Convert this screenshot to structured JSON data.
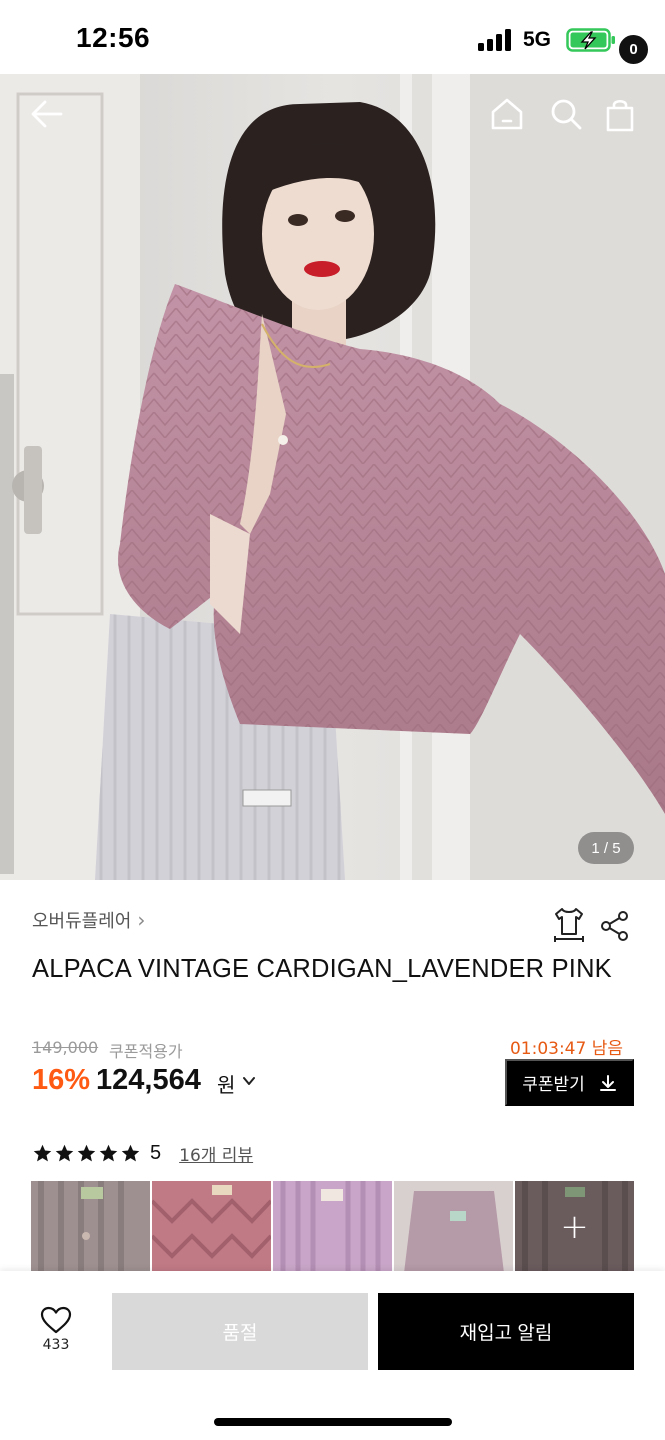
{
  "status_bar": {
    "time": "12:56",
    "network": "5G"
  },
  "header": {
    "cart_count": "0",
    "image_counter": "1 / 5"
  },
  "icons": {
    "back": "arrow-left-icon",
    "home": "home-icon",
    "search": "search-icon",
    "cart": "shopping-bag-icon",
    "fit": "size-fit-icon",
    "share": "share-icon",
    "chevron": "chevron-right-icon",
    "download": "download-icon",
    "wish": "heart-icon",
    "star": "star-icon"
  },
  "product": {
    "brand": "오버듀플레어",
    "brand_chevron": "›",
    "title": "ALPACA VINTAGE CARDIGAN_LAVENDER PINK",
    "original_price": "149,000",
    "coupon_label": "쿠폰적용가",
    "timer": "01:03:47 남음",
    "discount": "16%",
    "sale_price": "124,564",
    "currency": "원",
    "coupon_button": "쿠폰받기"
  },
  "reviews": {
    "rating": 5,
    "score_text": "5",
    "review_link": "16개 리뷰",
    "more": "+"
  },
  "bottom": {
    "wish_count": "433",
    "soldout_label": "품절",
    "restock_label": "재입고 알림"
  },
  "colors": {
    "discount": "#ff5a13",
    "timer": "#e65a14",
    "battery": "#34c759",
    "cardigan": "#b98a9d"
  }
}
